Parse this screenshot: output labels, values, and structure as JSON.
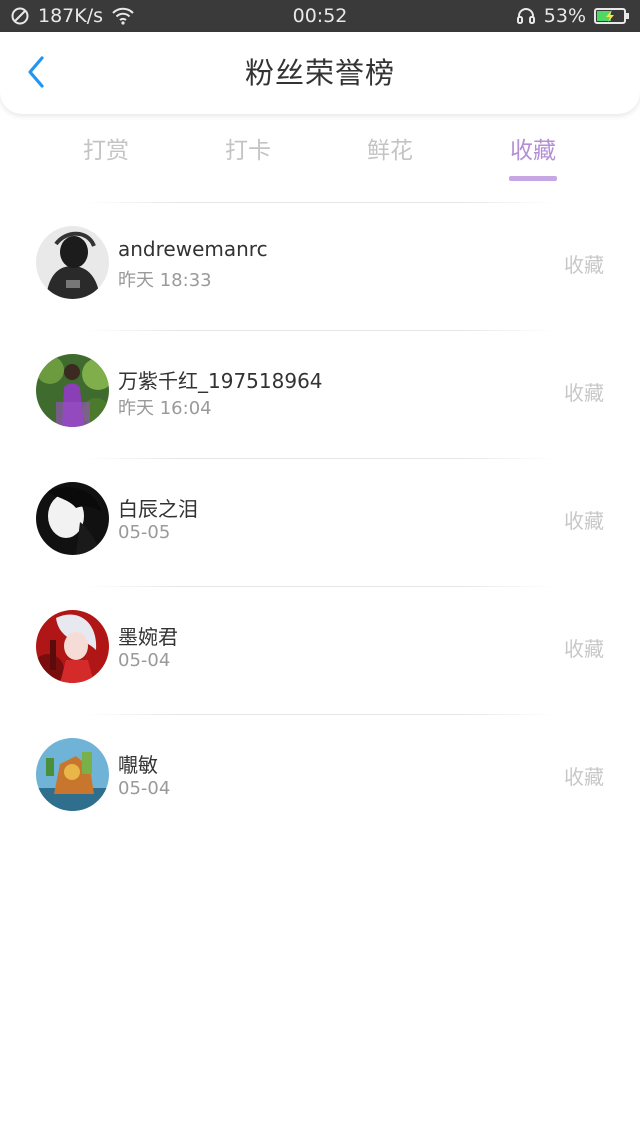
{
  "status_bar": {
    "speed": "187K/s",
    "time": "00:52",
    "battery_percent": "53%",
    "battery_level": 0.53,
    "icons": [
      "no-signal-icon",
      "wifi-icon",
      "headset-icon",
      "battery-charging-icon"
    ]
  },
  "header": {
    "title": "粉丝荣誉榜",
    "back_icon": "chevron-left-icon",
    "accent_color": "#2196f3"
  },
  "tabs": [
    {
      "label": "打赏",
      "active": false
    },
    {
      "label": "打卡",
      "active": false
    },
    {
      "label": "鲜花",
      "active": false
    },
    {
      "label": "收藏",
      "active": true
    }
  ],
  "theme": {
    "active_tab_color": "#b48fd6"
  },
  "list": [
    {
      "name": "andrewemanrc",
      "time": "昨天 18:33",
      "action": "收藏"
    },
    {
      "name": "万紫千红_197518964",
      "time": "昨天 16:04",
      "action": "收藏"
    },
    {
      "name": "白辰之泪",
      "time": "05-05",
      "action": "收藏"
    },
    {
      "name": "墨婉君",
      "time": "05-04",
      "action": "收藏"
    },
    {
      "name": "𡃁敏",
      "time": "05-04",
      "action": "收藏"
    }
  ]
}
